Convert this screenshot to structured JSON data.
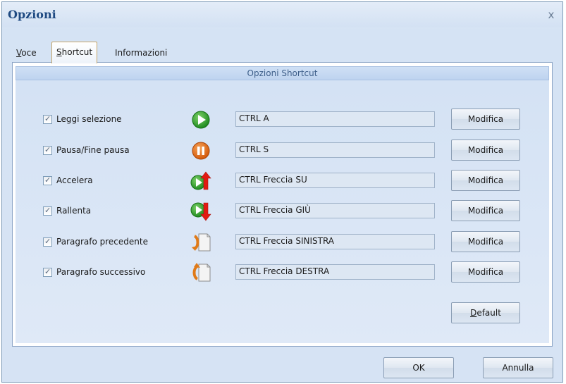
{
  "window": {
    "title": "Opzioni",
    "close_glyph": "x"
  },
  "tabs": [
    {
      "prefix": "",
      "accel": "V",
      "rest": "oce",
      "active": false
    },
    {
      "prefix": "",
      "accel": "S",
      "rest": "hortcut",
      "active": true
    },
    {
      "prefix": "",
      "accel": "",
      "rest": "Informazioni",
      "active": false
    }
  ],
  "panel": {
    "header": "Opzioni Shortcut"
  },
  "rows": [
    {
      "checked": true,
      "label": "Leggi selezione",
      "icon": "play-icon",
      "shortcut": "CTRL A",
      "button": "Modifica"
    },
    {
      "checked": true,
      "label": "Pausa/Fine pausa",
      "icon": "pause-icon",
      "shortcut": "CTRL S",
      "button": "Modifica"
    },
    {
      "checked": true,
      "label": "Accelera",
      "icon": "speed-up-icon",
      "shortcut": "CTRL Freccia SU",
      "button": "Modifica"
    },
    {
      "checked": true,
      "label": "Rallenta",
      "icon": "slow-down-icon",
      "shortcut": "CTRL Freccia GIÙ",
      "button": "Modifica"
    },
    {
      "checked": true,
      "label": "Paragrafo precedente",
      "icon": "previous-paragraph-icon",
      "shortcut": "CTRL Freccia SINISTRA",
      "button": "Modifica"
    },
    {
      "checked": true,
      "label": "Paragrafo successivo",
      "icon": "next-paragraph-icon",
      "shortcut": "CTRL Freccia DESTRA",
      "button": "Modifica"
    }
  ],
  "default_button": {
    "accel": "D",
    "rest": "efault"
  },
  "footer": {
    "ok_label": "OK",
    "cancel_label": "Annulla"
  },
  "colors": {
    "play_green": "#2e9b2a",
    "pause_orange": "#e36a0c",
    "arrow_red": "#e21a12",
    "paragraph_orange": "#e07a18"
  }
}
